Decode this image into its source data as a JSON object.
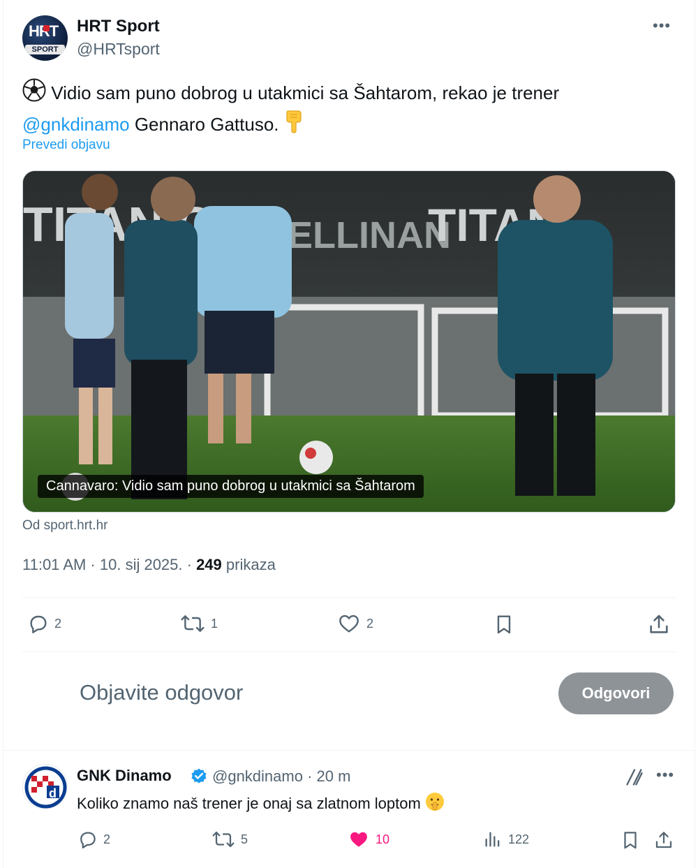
{
  "main_tweet": {
    "author_name": "HRT Sport",
    "author_handle": "@HRTsport",
    "avatar_top_text": "HRT",
    "avatar_bottom_text": "SPORT",
    "text_part1": " Vidio sam puno dobrog u utakmici sa Šahtarom, rekao je trener",
    "mention": "@gnkdinamo",
    "text_part2": " Gennaro Gattuso. ",
    "translate_label": "Prevedi objavu",
    "media_caption": "Cannavaro: Vidio sam puno dobrog u utakmici sa Šahtarom",
    "media_banner_text_1": "TITANIC",
    "media_banner_text_2": "DELLINAN",
    "media_banner_text_3": "TITAN",
    "source_label": "Od sport.hrt.hr",
    "time": "11:01 AM · 10. sij 2025. · ",
    "views_count": "249",
    "views_label": " prikaza",
    "replies": "2",
    "reposts": "1",
    "likes": "2"
  },
  "reply_composer": {
    "placeholder": "Objavite odgovor",
    "button_label": "Odgovori"
  },
  "reply_tweet": {
    "author_name": "GNK Dinamo",
    "author_handle": "@gnkdinamo",
    "time": " · 20 m",
    "text": "Koliko znamo naš trener je onaj sa zlatnom loptom ",
    "replies": "2",
    "reposts": "5",
    "likes": "10",
    "views": "122"
  },
  "colors": {
    "accent": "#1d9bf0",
    "muted": "#536471",
    "like_active": "#f91880",
    "button_disabled": "#8e9398"
  },
  "icons": [
    "more-icon",
    "soccer-ball-icon",
    "pointing-down-icon",
    "reply-icon",
    "repost-icon",
    "like-icon",
    "bookmark-icon",
    "share-icon",
    "verified-badge-icon",
    "grok-icon",
    "views-icon",
    "shush-emoji-icon"
  ]
}
